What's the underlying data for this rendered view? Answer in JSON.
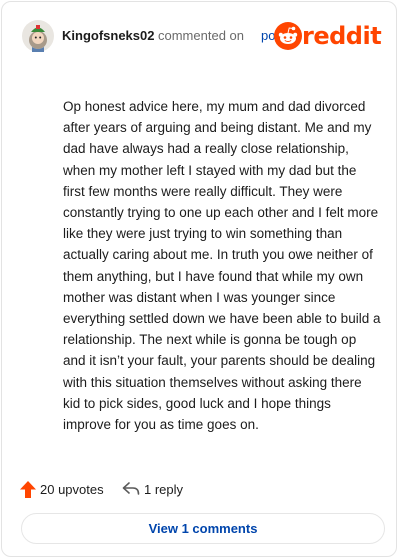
{
  "header": {
    "author": "Kingofsneks02",
    "commented_text": "commented on",
    "post_link": "post",
    "brand": "reddit",
    "brand_color": "#ff4500"
  },
  "comment": {
    "body": "Op honest advice here, my mum and dad divorced after years of arguing and being distant. Me and my dad have always had a really close relationship, when my mother left I stayed with my dad but the first few months were really difficult. They were constantly trying to one up each other and I felt more like they were just trying to win something than actually caring about me. In truth you owe neither of them anything, but I have found that while my own mother was distant when I was younger since everything settled down we have been able to build a relationship. The next while is gonna be tough op and it isn’t your fault, your parents should be dealing with this situation themselves without asking there kid to pick sides, good luck and I hope things improve for you as time goes on."
  },
  "actions": {
    "upvotes": "20 upvotes",
    "replies": "1 reply",
    "upvote_icon": "upvote-arrow-icon",
    "reply_icon": "reply-icon"
  },
  "footer": {
    "view_comments": "View 1 comments"
  }
}
